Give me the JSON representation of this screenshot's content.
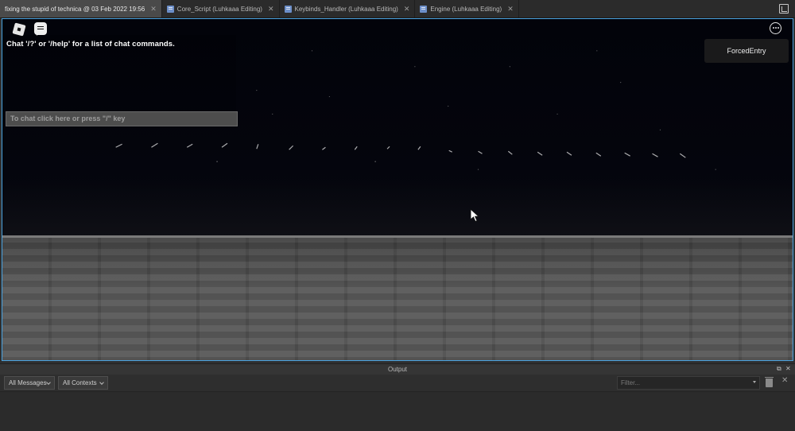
{
  "tabs": [
    {
      "label": "fixing the stupid of technica @ 03 Feb 2022 19:56",
      "active": true,
      "icon": ""
    },
    {
      "label": "Core_Script (Luhkaaa Editing)",
      "active": false,
      "icon": "script-icon"
    },
    {
      "label": "Keybinds_Handler (Luhkaaa Editing)",
      "active": false,
      "icon": "script-icon"
    },
    {
      "label": "Engine (Luhkaaa Editing)",
      "active": false,
      "icon": "module-icon"
    }
  ],
  "tab_close_glyph": "✕",
  "game": {
    "chat_help_text": "Chat '/?' or '/help' for a list of chat commands.",
    "chat_input_placeholder": "To chat click here or press \"/\" key",
    "player_name": "ForcedEntry"
  },
  "output": {
    "title": "Output",
    "messages_filter": "All Messages",
    "contexts_filter": "All Contexts",
    "filter_placeholder": "Filter...",
    "close_glyph": "✕",
    "restore_glyph": "⧉"
  },
  "colors": {
    "viewport_border": "#4aa3e0",
    "tab_active_bg": "#4a4a4a",
    "sky": "#03040b",
    "floor": "#565656"
  }
}
